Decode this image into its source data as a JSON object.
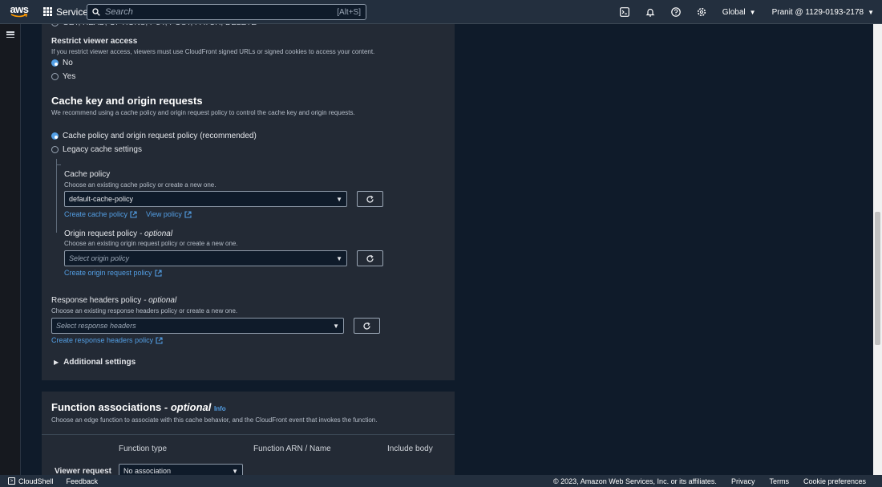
{
  "topnav": {
    "logo_text": "aws",
    "services_label": "Services",
    "search_placeholder": "Search",
    "search_shortcut": "[Alt+S]",
    "region_label": "Global",
    "account_label": "Pranit @ 1129-0193-2178"
  },
  "panel_top": {
    "methods_partial": "GET, HEAD, OPTIONS, PUT, POST, PATCH, DELETE",
    "restrict": {
      "title": "Restrict viewer access",
      "description": "If you restrict viewer access, viewers must use CloudFront signed URLs or signed cookies to access your content.",
      "options": [
        "No",
        "Yes"
      ],
      "selected": "No"
    },
    "cache_key": {
      "heading": "Cache key and origin requests",
      "description": "We recommend using a cache policy and origin request policy to control the cache key and origin requests.",
      "options": [
        "Cache policy and origin request policy (recommended)",
        "Legacy cache settings"
      ],
      "selected": "Cache policy and origin request policy (recommended)"
    },
    "cache_policy": {
      "title": "Cache policy",
      "description": "Choose an existing cache policy or create a new one.",
      "value": "default-cache-policy",
      "create_link": "Create cache policy",
      "view_link": "View policy"
    },
    "origin_request_policy": {
      "title": "Origin request policy",
      "optional": "- optional",
      "description": "Choose an existing origin request policy or create a new one.",
      "placeholder": "Select origin policy",
      "create_link": "Create origin request policy"
    },
    "response_headers_policy": {
      "title": "Response headers policy",
      "optional": "- optional",
      "description": "Choose an existing response headers policy or create a new one.",
      "placeholder": "Select response headers",
      "create_link": "Create response headers policy"
    },
    "additional_settings": "Additional settings"
  },
  "function_assoc": {
    "heading": "Function associations",
    "optional": "- optional",
    "info": "Info",
    "description": "Choose an edge function to associate with this cache behavior, and the CloudFront event that invokes the function.",
    "columns": [
      "Function type",
      "Function ARN / Name",
      "Include body"
    ],
    "row_label": "Viewer request",
    "row_value": "No association"
  },
  "footer": {
    "cloudshell": "CloudShell",
    "feedback": "Feedback",
    "copyright": "© 2023, Amazon Web Services, Inc. or its affiliates.",
    "privacy": "Privacy",
    "terms": "Terms",
    "cookie": "Cookie preferences"
  },
  "colors": {
    "accent": "#539fe5",
    "panel": "#232a35",
    "background": "#0f1b2a",
    "nav": "#232f3e",
    "aws_smile": "#ff9900"
  }
}
